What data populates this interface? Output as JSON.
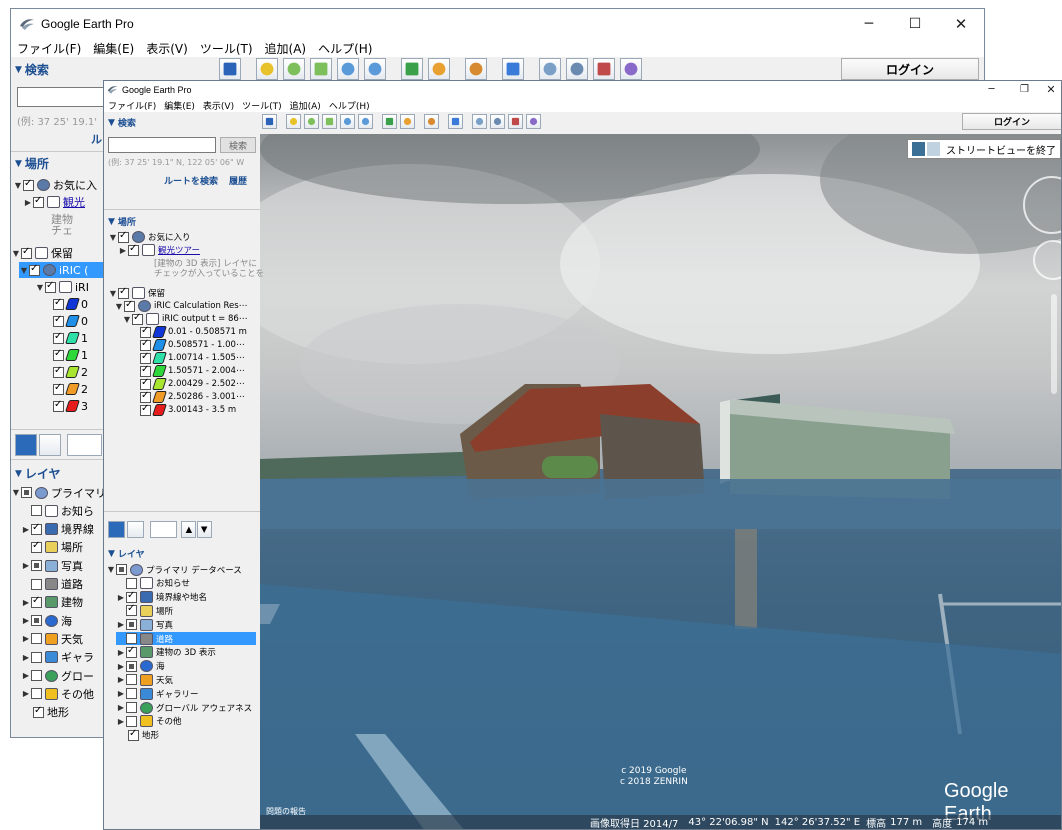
{
  "app": {
    "title": "Google Earth Pro"
  },
  "menu": {
    "items": [
      "ファイル(F)",
      "編集(E)",
      "表示(V)",
      "ツール(T)",
      "追加(A)",
      "ヘルプ(H)"
    ]
  },
  "toolbar": {
    "login_label": "ログイン"
  },
  "search": {
    "header": "検索",
    "placeholder_hint": "(例: 37 25' 19.1\" N, 122 05' 06\" W",
    "back_hint": "(例: 37 25' 19.1'",
    "search_button": "検索",
    "route_link": "ルートを検索",
    "history_link": "履歴",
    "back_route": "ル"
  },
  "places": {
    "header": "場所",
    "items": [
      {
        "label": "お気に入り",
        "icon": "earth-icon",
        "checked": true
      },
      {
        "label": "観光ツアー",
        "icon": "folder-icon",
        "checked": true,
        "link": true
      },
      {
        "label": "[建物の 3D 表示] レイヤに",
        "grey": true
      },
      {
        "label": "チェックが入っていることを",
        "grey": true
      },
      {
        "label": "保留",
        "icon": "folder-icon",
        "checked": true
      },
      {
        "label": "iRIC Calculation Res⋯",
        "icon": "earth-icon",
        "checked": true
      },
      {
        "label": "iRIC output t = 86⋯",
        "icon": "folder-icon",
        "checked": true
      },
      {
        "label": "0.01 - 0.508571 m",
        "color": "#1036d8",
        "checked": true
      },
      {
        "label": "0.508571 - 1.00⋯",
        "color": "#1f8fe8",
        "checked": true
      },
      {
        "label": "1.00714 - 1.505⋯",
        "color": "#2ee0a8",
        "checked": true
      },
      {
        "label": "1.50571 - 2.004⋯",
        "color": "#2ed83a",
        "checked": true
      },
      {
        "label": "2.00429 - 2.502⋯",
        "color": "#a8e630",
        "checked": true
      },
      {
        "label": "2.50286 - 3.001⋯",
        "color": "#f09a28",
        "checked": true
      },
      {
        "label": "3.00143 - 3.5 m",
        "color": "#e51c1c",
        "checked": true
      }
    ],
    "back_items": [
      {
        "label": "お気に入",
        "checked": true
      },
      {
        "label": "観光",
        "checked": true,
        "link": true
      },
      {
        "label": "建物",
        "grey": true
      },
      {
        "label": "チェ",
        "grey": true
      },
      {
        "label": "保留",
        "checked": true
      },
      {
        "label": "iRIC (",
        "checked": true,
        "selected": true
      },
      {
        "label": "iRI",
        "checked": true
      }
    ],
    "back_swatch_labels": [
      "0",
      "0",
      "1",
      "1",
      "2",
      "2",
      "3"
    ]
  },
  "layers": {
    "header": "レイヤ",
    "items": [
      {
        "label": "プライマリ データベース",
        "icon": "earth-layers-icon",
        "state": "mix",
        "expand": true
      },
      {
        "label": "お知らせ",
        "icon": "mail-icon",
        "state": "off"
      },
      {
        "label": "境界線や地名",
        "icon": "flag-icon",
        "state": "on",
        "expand": true
      },
      {
        "label": "場所",
        "icon": "place-icon",
        "state": "on"
      },
      {
        "label": "写真",
        "icon": "photo-icon",
        "state": "mix",
        "expand": true
      },
      {
        "label": "道路",
        "icon": "road-icon",
        "state": "off",
        "selected": true
      },
      {
        "label": "建物の 3D 表示",
        "icon": "building-icon",
        "state": "on",
        "expand": true
      },
      {
        "label": "海",
        "icon": "ocean-icon",
        "state": "mix",
        "expand": true
      },
      {
        "label": "天気",
        "icon": "weather-icon",
        "state": "off",
        "expand": true
      },
      {
        "label": "ギャラリー",
        "icon": "gallery-icon",
        "state": "off",
        "expand": true
      },
      {
        "label": "グローバル アウェアネス",
        "icon": "globe-icon",
        "state": "off",
        "expand": true
      },
      {
        "label": "その他",
        "icon": "other-icon",
        "state": "off",
        "expand": true
      },
      {
        "label": "地形",
        "icon": "",
        "state": "on"
      }
    ],
    "back_items": [
      "プライマリ",
      "お知ら",
      "境界線",
      "場所",
      "写真",
      "道路",
      "建物",
      "海",
      "天気",
      "ギャラ",
      "グロー",
      "その他",
      "地形"
    ]
  },
  "view": {
    "streetview_exit": "ストリートビューを終了",
    "attribution": [
      "c 2019 Google",
      "c 2018 ZENRIN"
    ],
    "logo": "Google Earth",
    "report": "問題の報告",
    "status": {
      "date": "画像取得日 2014/7",
      "lat": "43° 22'06.98\" N",
      "lon": "142° 26'37.52\" E",
      "elev_label": "標高",
      "elev": "177 m",
      "alt_label": "高度",
      "alt": "174 m"
    }
  }
}
